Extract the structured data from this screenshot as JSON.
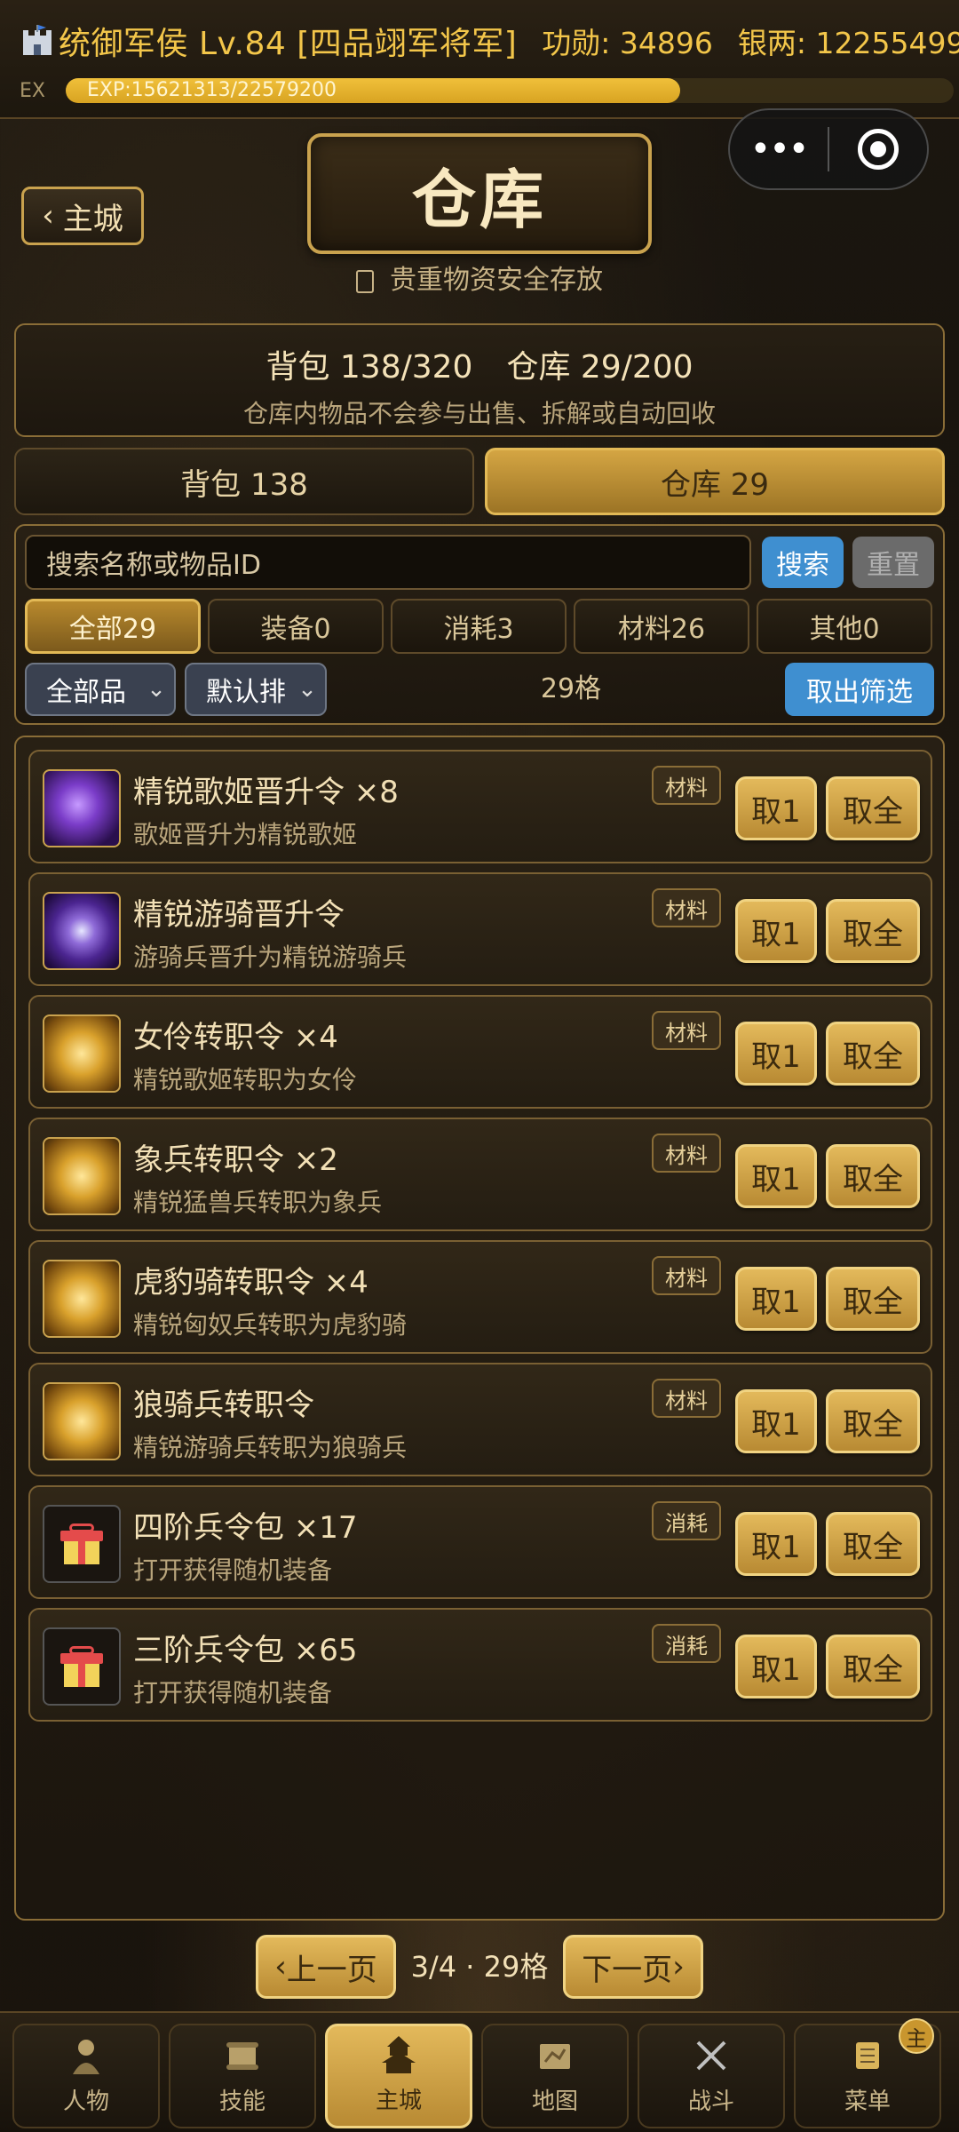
{
  "status": {
    "title": "统御军侯 Lv.84 [四品翊军将军]",
    "merit": "功勋: 34896",
    "silver": "银两: 12255499",
    "exp_label": "EX",
    "exp_text": "EXP:15621313/22579200",
    "exp_progress": 0.6918
  },
  "header": {
    "back_label": "主城",
    "title": "仓库",
    "subtitle": "贵重物资安全存放"
  },
  "capacity": {
    "bag": "背包 138/320",
    "storage": "仓库 29/200",
    "note": "仓库内物品不会参与出售、拆解或自动回收"
  },
  "tabs": {
    "bag": "背包 138",
    "storage": "仓库 29"
  },
  "filters": {
    "search_placeholder": "搜索名称或物品ID",
    "search_label": "搜索",
    "reset_label": "重置",
    "categories": [
      "全部29",
      "装备0",
      "消耗3",
      "材料26",
      "其他0"
    ],
    "quality_value": "全部品",
    "sort_value": "默认排",
    "count": "29格",
    "export_label": "取出筛选"
  },
  "items": [
    {
      "name": "精锐歌姬晋升令 ×8",
      "desc": "歌姬晋升为精锐歌姬",
      "tag": "材料",
      "icon": "purple-scroll-icon"
    },
    {
      "name": "精锐游骑晋升令",
      "desc": "游骑兵晋升为精锐游骑兵",
      "tag": "材料",
      "icon": "purple-medal-icon"
    },
    {
      "name": "女伶转职令 ×4",
      "desc": "精锐歌姬转职为女伶",
      "tag": "材料",
      "icon": "gold-token-icon"
    },
    {
      "name": "象兵转职令 ×2",
      "desc": "精锐猛兽兵转职为象兵",
      "tag": "材料",
      "icon": "gold-token-icon"
    },
    {
      "name": "虎豹骑转职令 ×4",
      "desc": "精锐匈奴兵转职为虎豹骑",
      "tag": "材料",
      "icon": "gold-token-icon"
    },
    {
      "name": "狼骑兵转职令",
      "desc": "精锐游骑兵转职为狼骑兵",
      "tag": "材料",
      "icon": "gold-token-icon"
    },
    {
      "name": "四阶兵令包 ×17",
      "desc": "打开获得随机装备",
      "tag": "消耗",
      "icon": "gift-box-icon"
    },
    {
      "name": "三阶兵令包 ×65",
      "desc": "打开获得随机装备",
      "tag": "消耗",
      "icon": "gift-box-icon"
    }
  ],
  "item_actions": {
    "take_one": "取1",
    "take_all": "取全"
  },
  "pagination": {
    "prev_label": "上一页",
    "info": "3/4 · 29格",
    "next_label": "下一页"
  },
  "nav": [
    {
      "label": "人物",
      "icon": "character-icon"
    },
    {
      "label": "技能",
      "icon": "skill-scroll-icon"
    },
    {
      "label": "主城",
      "icon": "city-tower-icon"
    },
    {
      "label": "地图",
      "icon": "map-icon"
    },
    {
      "label": "战斗",
      "icon": "crossed-swords-icon"
    },
    {
      "label": "菜单",
      "icon": "menu-scroll-icon"
    }
  ],
  "nav_badge": "主",
  "colors": {
    "gold_accent": "#f3c64a",
    "blue_button": "#3f8fd0",
    "panel_border": "#8a6d37"
  }
}
